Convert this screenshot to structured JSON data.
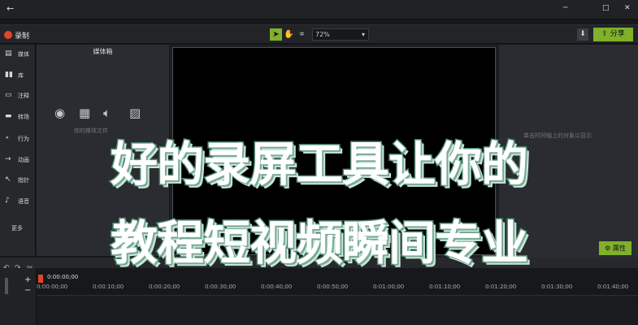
{
  "window": {
    "back": "←",
    "minimize": "─",
    "maximize": "□",
    "close": "✕"
  },
  "toolbar": {
    "record_label": "录制",
    "zoom_value": "72%",
    "share_label": "分享",
    "download": "⬇"
  },
  "sidebar": {
    "items": [
      {
        "label": "媒体",
        "icon": "film-icon"
      },
      {
        "label": "库",
        "icon": "library-icon"
      },
      {
        "label": "注释",
        "icon": "annotation-icon"
      },
      {
        "label": "转场",
        "icon": "transition-icon"
      },
      {
        "label": "行为",
        "icon": "behavior-icon"
      },
      {
        "label": "动画",
        "icon": "animation-icon"
      },
      {
        "label": "指针",
        "icon": "cursor-icon"
      },
      {
        "label": "语音",
        "icon": "voice-icon"
      }
    ],
    "more_label": "更多"
  },
  "media_bin": {
    "title": "媒体箱",
    "hint": "你的媒体文件"
  },
  "properties": {
    "hint": "单击时间轴上的对象以显示",
    "button_label": "属性"
  },
  "timeline": {
    "playhead_time": "0:00:00;00",
    "ticks": [
      "0:00:00;00",
      "0:00:10;00",
      "0:00:20;00",
      "0:00:30;00",
      "0:00:40;00",
      "0:00:50;00",
      "0:01:00;00",
      "0:01:10;00",
      "0:01:20;00",
      "0:01:30;00",
      "0:01:40;00"
    ]
  },
  "overlay": {
    "line1": "好的录屏工具让你的",
    "line2": "教程短视频瞬间专业"
  },
  "colors": {
    "accent": "#7fb12a",
    "record": "#e2452c",
    "overlay_stroke": "#4e8a74"
  }
}
